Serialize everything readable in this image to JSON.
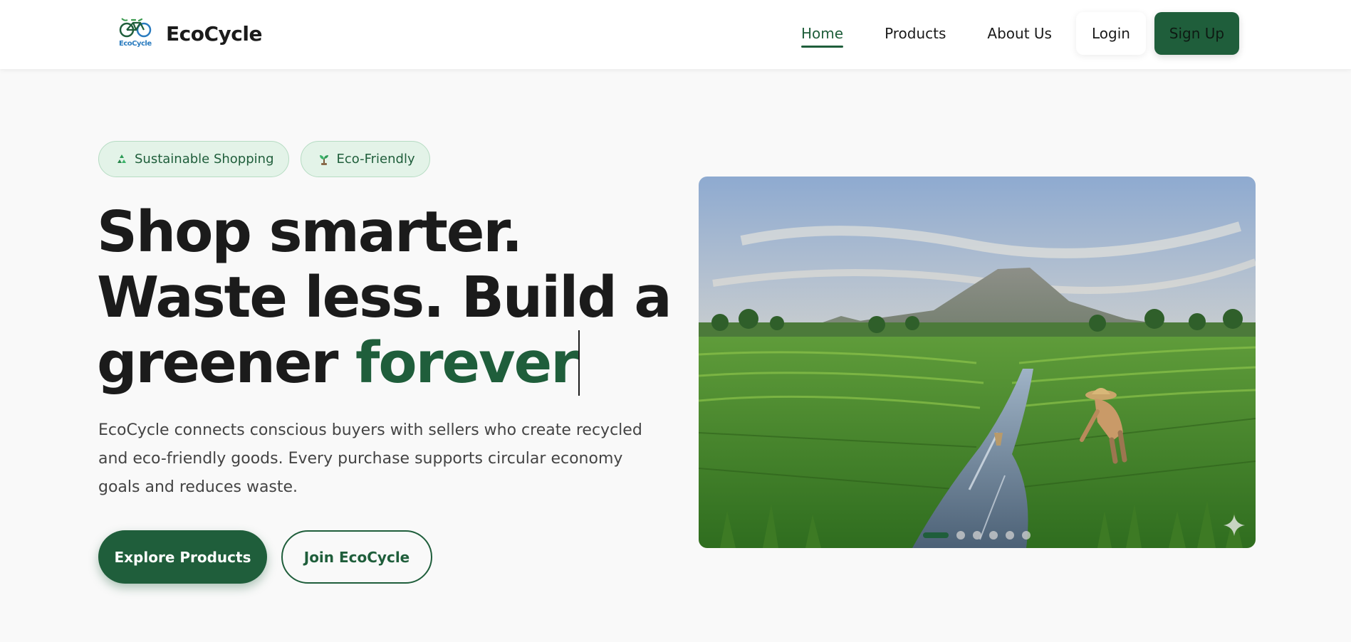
{
  "brand": {
    "name": "EcoCycle",
    "logo_icon": "bicycle-logo-icon",
    "logo_caption": "EcoCycle",
    "accent_color": "#1f5e3b"
  },
  "nav": {
    "links": [
      {
        "label": "Home",
        "active": true
      },
      {
        "label": "Products",
        "active": false
      },
      {
        "label": "About Us",
        "active": false
      }
    ],
    "login_label": "Login",
    "signup_label": "Sign Up"
  },
  "hero": {
    "chips": [
      {
        "icon": "recycle-icon",
        "label": "Sustainable Shopping"
      },
      {
        "icon": "seedling-icon",
        "label": "Eco-Friendly"
      }
    ],
    "headline_line1": "Shop smarter.",
    "headline_line2": "Waste less. Build a",
    "headline_line3_prefix": "greener ",
    "headline_accent": "forever",
    "description": "EcoCycle connects conscious buyers with sellers who create recycled and eco-friendly goods. Every purchase supports circular economy goals and reduces waste.",
    "primary_cta": "Explore Products",
    "secondary_cta": "Join EcoCycle"
  },
  "carousel": {
    "image_subject": "rice-terraces-volcano-farmer-image",
    "slide_count": 6,
    "active_index": 0,
    "corner_icon": "sparkle-icon"
  }
}
